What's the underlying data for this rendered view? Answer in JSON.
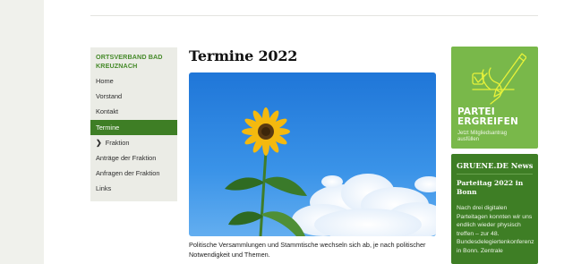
{
  "sidebar": {
    "title": "ORTSVERBAND BAD KREUZNACH",
    "items": [
      {
        "label": "Home",
        "active": false
      },
      {
        "label": "Vorstand",
        "active": false
      },
      {
        "label": "Kontakt",
        "active": false
      },
      {
        "label": "Termine",
        "active": true
      },
      {
        "label": "Fraktion",
        "active": false,
        "icon": "chevron-right-icon",
        "icon_glyph": "❯"
      },
      {
        "label": "Anträge der Fraktion",
        "active": false
      },
      {
        "label": "Anfragen der Fraktion",
        "active": false
      },
      {
        "label": "Links",
        "active": false
      }
    ]
  },
  "main": {
    "title": "Termine 2022",
    "hero_image": "sunflower-under-blue-sky",
    "body_lines": [
      "Politische Versammlungen und Stammtische wechseln sich ab, je nach politischer",
      "Notwendigkeit und Themen."
    ]
  },
  "promo": {
    "title_line1": "PARTEI",
    "title_line2": "ERGREIFEN",
    "subtitle": "Jetzt Mitgliedsantrag ausfüllen",
    "icon": "hand-writing-checkmark-icon"
  },
  "news": {
    "heading": "GRUENE.DE News",
    "title": "Parteitag 2022 in Bonn",
    "body": "Nach drei digitalen Parteitagen konnten wir uns endlich wieder physisch treffen – zur 48. Bundesdelegiertenkonferenz in Bonn. Zentrale"
  },
  "colors": {
    "green_dark": "#3e7e25",
    "green_light": "#79b84a",
    "green_text": "#468a2a",
    "sky": "#2f86e0"
  }
}
